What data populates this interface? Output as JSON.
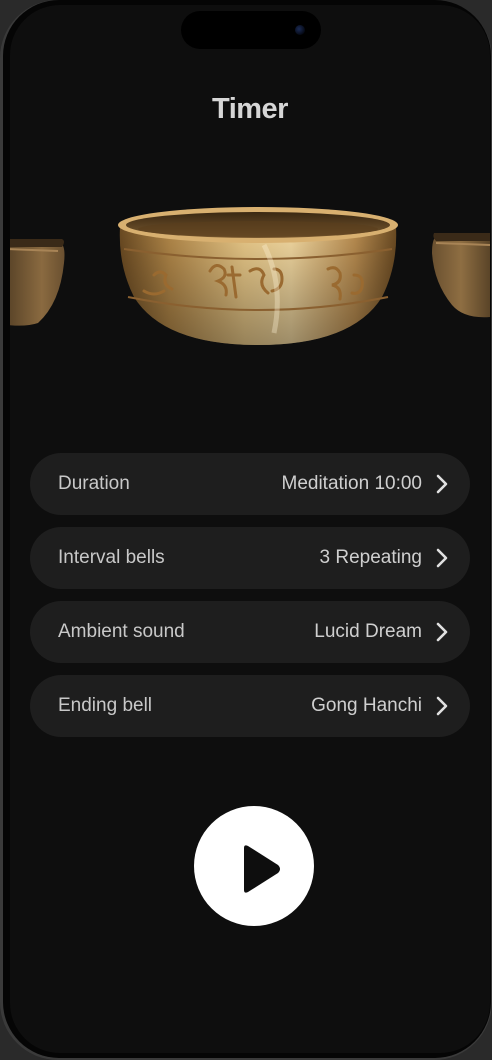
{
  "header": {
    "title": "Timer"
  },
  "carousel": {
    "items": [
      "singing-bowl",
      "singing-bowl",
      "singing-bowl"
    ],
    "selected_index": 1
  },
  "settings": {
    "rows": [
      {
        "label": "Duration",
        "value": "Meditation 10:00"
      },
      {
        "label": "Interval bells",
        "value": "3 Repeating"
      },
      {
        "label": "Ambient sound",
        "value": "Lucid Dream"
      },
      {
        "label": "Ending bell",
        "value": "Gong Hanchi"
      }
    ]
  },
  "controls": {
    "play_icon": "play-icon"
  },
  "colors": {
    "background": "#0e0e0e",
    "row_background": "#1e1e1e",
    "text": "#c8c8c8",
    "bowl_gold": "#c8a060",
    "play_button": "#ffffff"
  }
}
